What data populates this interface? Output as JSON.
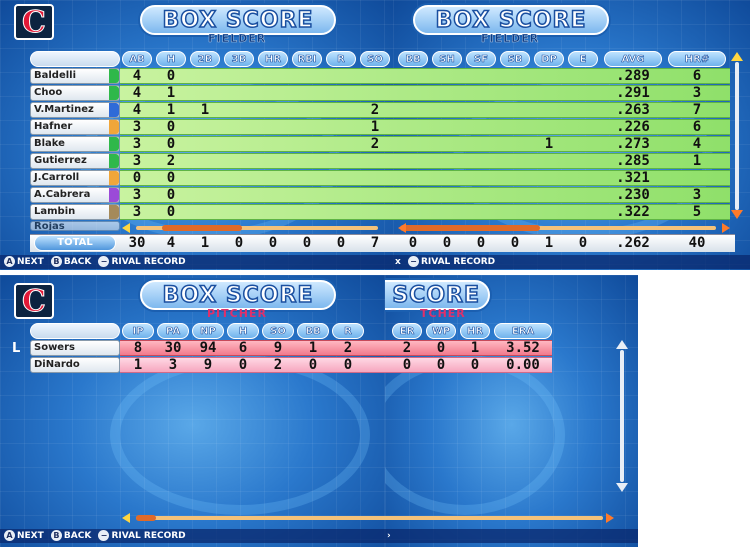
{
  "team_logo_letter": "C",
  "colors": {
    "team_navy": "#0c2340",
    "team_red": "#e31937",
    "row_green": "#8fe06a",
    "row_red": "#f27a8c",
    "scroll_orange": "#e06a28"
  },
  "fielder": {
    "title": "BOX SCORE",
    "subtitle": "FIELDER",
    "columns_left": [
      "AB",
      "H",
      "2B",
      "3B",
      "HR",
      "RBI",
      "R",
      "SO"
    ],
    "columns_right": [
      "BB",
      "SH",
      "SF",
      "SB",
      "DP",
      "E",
      "AVG",
      "HR#"
    ],
    "players": [
      {
        "name": "Baldelli",
        "tag": "#2fb84a",
        "left": [
          "4",
          "0",
          "",
          "",
          "",
          "",
          "",
          ""
        ],
        "right": [
          "",
          "",
          "",
          "",
          "",
          "",
          ".289",
          "6"
        ]
      },
      {
        "name": "Choo",
        "tag": "#2fb84a",
        "left": [
          "4",
          "1",
          "",
          "",
          "",
          "",
          "",
          ""
        ],
        "right": [
          "",
          "",
          "",
          "",
          "",
          "",
          ".291",
          "3"
        ]
      },
      {
        "name": "V.Martinez",
        "tag": "#2f6ad8",
        "left": [
          "4",
          "1",
          "1",
          "",
          "",
          "",
          "",
          "2"
        ],
        "right": [
          "",
          "",
          "",
          "",
          "",
          "",
          ".263",
          "7"
        ]
      },
      {
        "name": "Hafner",
        "tag": "#f0a63a",
        "left": [
          "3",
          "0",
          "",
          "",
          "",
          "",
          "",
          "1"
        ],
        "right": [
          "",
          "",
          "",
          "",
          "",
          "",
          ".226",
          "6"
        ]
      },
      {
        "name": "Blake",
        "tag": "#2fb84a",
        "left": [
          "3",
          "0",
          "",
          "",
          "",
          "",
          "",
          "2"
        ],
        "right": [
          "",
          "",
          "",
          "",
          "1",
          "",
          ".273",
          "4"
        ]
      },
      {
        "name": "Gutierrez",
        "tag": "#2fb84a",
        "left": [
          "3",
          "2",
          "",
          "",
          "",
          "",
          "",
          ""
        ],
        "right": [
          "",
          "",
          "",
          "",
          "",
          "",
          ".285",
          "1"
        ]
      },
      {
        "name": "J.Carroll",
        "tag": "#f0a63a",
        "left": [
          "0",
          "0",
          "",
          "",
          "",
          "",
          "",
          ""
        ],
        "right": [
          "",
          "",
          "",
          "",
          "",
          "",
          ".321",
          ""
        ]
      },
      {
        "name": "A.Cabrera",
        "tag": "#9b4ad8",
        "left": [
          "3",
          "0",
          "",
          "",
          "",
          "",
          "",
          ""
        ],
        "right": [
          "",
          "",
          "",
          "",
          "",
          "",
          ".230",
          "3"
        ]
      },
      {
        "name": "Lambin",
        "tag": "#a58a5a",
        "left": [
          "3",
          "0",
          "",
          "",
          "",
          "",
          "",
          ""
        ],
        "right": [
          "",
          "",
          "",
          "",
          "",
          "",
          ".322",
          "5"
        ]
      }
    ],
    "partial_row_name": "Rojas",
    "total_label": "TOTAL",
    "totals_left": [
      "30",
      "4",
      "1",
      "0",
      "0",
      "0",
      "0",
      "7"
    ],
    "totals_right": [
      "0",
      "0",
      "0",
      "0",
      "1",
      "0",
      ".262",
      "40"
    ]
  },
  "pitcher": {
    "title": "BOX SCORE",
    "title_right_visible": "SCORE",
    "subtitle": "PITCHER",
    "subtitle_right_visible": "TCHER",
    "columns": [
      "IP",
      "PA",
      "NP",
      "H",
      "SO",
      "BB",
      "R",
      "ER",
      "WP",
      "HR",
      "ERA"
    ],
    "decision": "L",
    "players": [
      {
        "name": "Sowers",
        "values": [
          "8",
          "30",
          "94",
          "6",
          "9",
          "1",
          "2",
          "2",
          "0",
          "1",
          "3.52"
        ]
      },
      {
        "name": "DiNardo",
        "values": [
          "1",
          "3",
          "9",
          "0",
          "2",
          "0",
          "0",
          "0",
          "0",
          "0",
          "0.00"
        ]
      }
    ]
  },
  "footer": {
    "btn_a": "A",
    "next": "NEXT",
    "btn_b": "B",
    "back": "BACK",
    "btn_minus": "−",
    "rival": "RIVAL RECORD",
    "fragment_x": "x"
  }
}
